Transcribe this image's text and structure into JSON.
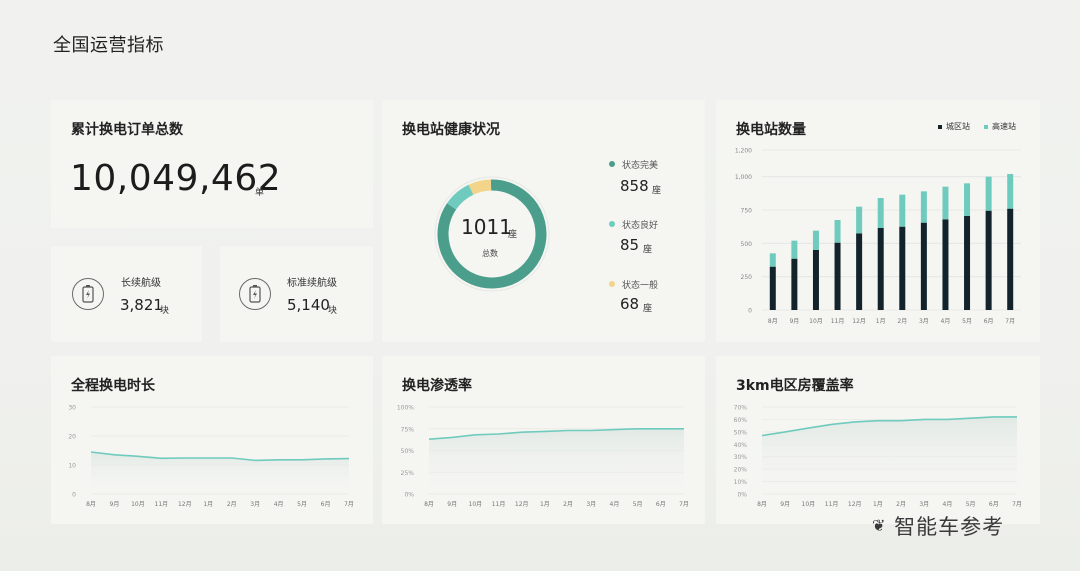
{
  "page_title": "全国运营指标",
  "cards": {
    "total_orders": {
      "title": "累计换电订单总数",
      "value": "10,049,462",
      "unit": "单",
      "long_range": {
        "label": "长续航级",
        "value": "3,821",
        "unit": "块"
      },
      "standard_range": {
        "label": "标准续航级",
        "value": "5,140",
        "unit": "块"
      }
    },
    "health": {
      "title": "换电站健康状况",
      "center_value": "1011",
      "center_unit": "座",
      "center_sub": "总数",
      "legend": [
        {
          "label": "状态完美",
          "value": "858",
          "unit": "座",
          "color": "#4c9e8c"
        },
        {
          "label": "状态良好",
          "value": "85",
          "unit": "座",
          "color": "#6fcbbd"
        },
        {
          "label": "状态一般",
          "value": "68",
          "unit": "座",
          "color": "#f2d48a"
        }
      ]
    },
    "station_count": {
      "title": "换电站数量",
      "legend": [
        {
          "label": "城区站",
          "color": "#13232b"
        },
        {
          "label": "高速站",
          "color": "#6fcbbd"
        }
      ]
    },
    "duration": {
      "title": "全程换电时长"
    },
    "penetration": {
      "title": "换电渗透率"
    },
    "coverage": {
      "title": "3km电区房覆盖率"
    }
  },
  "chart_data": [
    {
      "id": "health-donut",
      "type": "pie",
      "title": "换电站健康状况",
      "categories": [
        "状态完美",
        "状态良好",
        "状态一般"
      ],
      "values": [
        858,
        85,
        68
      ],
      "colors": [
        "#4c9e8c",
        "#6fcbbd",
        "#f2d48a"
      ]
    },
    {
      "id": "station-bars",
      "type": "bar",
      "stacked": true,
      "title": "换电站数量",
      "categories": [
        "8月",
        "9月",
        "10月",
        "11月",
        "12月",
        "1月",
        "2月",
        "3月",
        "4月",
        "5月",
        "6月",
        "7月"
      ],
      "yticks": [
        "0",
        "250",
        "500",
        "750",
        "1,000",
        "1,200"
      ],
      "ylim": [
        0,
        1200
      ],
      "series": [
        {
          "name": "城区站",
          "color": "#13232b",
          "values": [
            325,
            385,
            450,
            505,
            575,
            615,
            625,
            655,
            680,
            705,
            745,
            760
          ]
        },
        {
          "name": "高速站",
          "color": "#6fcbbd",
          "values": [
            100,
            135,
            145,
            170,
            200,
            225,
            240,
            235,
            245,
            245,
            255,
            260
          ]
        }
      ]
    },
    {
      "id": "duration-line",
      "type": "area",
      "title": "全程换电时长",
      "categories": [
        "8月",
        "9月",
        "10月",
        "11月",
        "12月",
        "1月",
        "2月",
        "3月",
        "4月",
        "5月",
        "6月",
        "7月"
      ],
      "yticks": [
        "0",
        "10",
        "20",
        "30"
      ],
      "ylim": [
        0,
        30
      ],
      "values": [
        14.5,
        13.5,
        13,
        12.3,
        12.4,
        12.4,
        12.4,
        11.6,
        11.8,
        11.8,
        12.1,
        12.2
      ],
      "color": "#6fcbbd"
    },
    {
      "id": "penetration-line",
      "type": "area",
      "title": "换电渗透率",
      "categories": [
        "8月",
        "9月",
        "10月",
        "11月",
        "12月",
        "1月",
        "2月",
        "3月",
        "4月",
        "5月",
        "6月",
        "7月"
      ],
      "yticks": [
        "0%",
        "25%",
        "50%",
        "75%",
        "100%"
      ],
      "ylim": [
        0,
        100
      ],
      "values": [
        63,
        65,
        68,
        69,
        71,
        72,
        73,
        73,
        74,
        75,
        75,
        75
      ],
      "color": "#6fcbbd"
    },
    {
      "id": "coverage-line",
      "type": "area",
      "title": "3km电区房覆盖率",
      "categories": [
        "8月",
        "9月",
        "10月",
        "11月",
        "12月",
        "1月",
        "2月",
        "3月",
        "4月",
        "5月",
        "6月",
        "7月"
      ],
      "yticks": [
        "0%",
        "10%",
        "20%",
        "30%",
        "40%",
        "50%",
        "60%",
        "70%"
      ],
      "ylim": [
        0,
        70
      ],
      "values": [
        47,
        50,
        53,
        56,
        58,
        59,
        59,
        60,
        60,
        61,
        62,
        62
      ],
      "color": "#6fcbbd"
    }
  ],
  "watermark": "智能车参考"
}
